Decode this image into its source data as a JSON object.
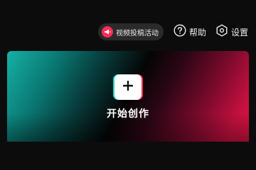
{
  "header": {
    "activity_label": "视频投稿活动",
    "help_label": "帮助",
    "settings_label": "设置",
    "activity_icon": "megaphone-icon",
    "help_icon": "question-circle-icon",
    "settings_icon": "hexagon-gear-icon"
  },
  "create_card": {
    "label": "开始创作",
    "icon": "plus-icon"
  },
  "colors": {
    "background": "#0c0c0c",
    "accent_red": "#fe2c55",
    "accent_cyan": "#22d3c5",
    "gradient_teal": "#16b0a6",
    "gradient_crimson": "#d8133f"
  }
}
